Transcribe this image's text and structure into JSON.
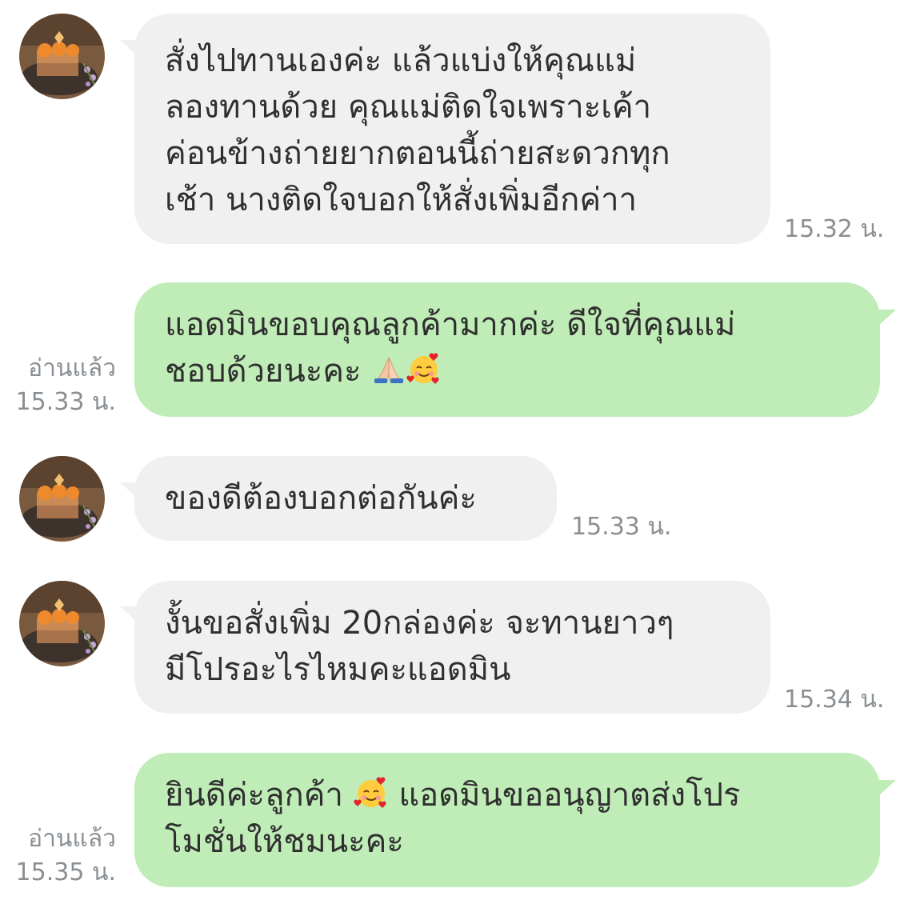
{
  "messages": [
    {
      "direction": "incoming",
      "lines": [
        "สั่งไปทานเองค่ะ แล้วแบ่งให้คุณแม่",
        "ลองทานด้วย คุณแม่ติดใจเพราะเค้า",
        "ค่อนข้างถ่ายยากตอนนี้ถ่ายสะดวกทุก",
        "เช้า นางติดใจบอกให้สั่งเพิ่มอีกค่าา"
      ],
      "time": "15.32 น."
    },
    {
      "direction": "outgoing",
      "lines": [
        "แอดมินขอบคุณลูกค้ามากค่ะ ดีใจที่คุณแม่",
        "ชอบด้วยนะคะ "
      ],
      "emoji_icons": [
        "folded-hands-icon",
        "smiling-face-with-hearts-icon"
      ],
      "read": "อ่านแล้ว",
      "time": "15.33 น."
    },
    {
      "direction": "incoming",
      "lines": [
        "ของดีต้องบอกต่อกันค่ะ"
      ],
      "time": "15.33 น."
    },
    {
      "direction": "incoming",
      "lines": [
        "งั้นขอสั่งเพิ่ม 20กล่องค่ะ จะทานยาวๆ",
        "มีโปรอะไรไหมคะแอดมิน"
      ],
      "time": "15.34 น."
    },
    {
      "direction": "outgoing",
      "lines": [
        "ยินดีค่ะลูกค้า ",
        " แอดมินขออนุญาตส่งโปร",
        "โมชั่นให้ชมนะคะ"
      ],
      "emoji_icons": [
        "smiling-face-with-hearts-icon"
      ],
      "read": "อ่านแล้ว",
      "time": "15.35 น."
    }
  ],
  "colors": {
    "incoming_bubble": "#f0f0f1",
    "outgoing_bubble": "#bfecb7",
    "meta_text": "#8a8f93",
    "message_text": "#2f2f2f"
  }
}
